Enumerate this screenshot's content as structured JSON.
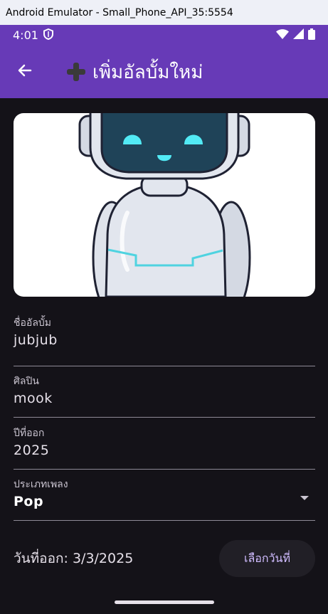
{
  "window": {
    "title": "Android Emulator - Small_Phone_API_35:5554"
  },
  "status_bar": {
    "time": "4:01",
    "icons": [
      "shield-icon",
      "wifi-icon",
      "signal-icon",
      "battery-icon"
    ]
  },
  "app_bar": {
    "title": "เพิ่มอัลบั้มใหม่",
    "back_icon": "arrow-back-icon",
    "title_icon": "heavy-plus-emoji"
  },
  "hero": {
    "image": "robot-illustration"
  },
  "form": {
    "album_name": {
      "label": "ชื่ออัลบั้ม",
      "value": "jubjub"
    },
    "artist": {
      "label": "ศิลปิน",
      "value": "mook"
    },
    "release_year": {
      "label": "ปีที่ออก",
      "value": "2025"
    },
    "genre": {
      "label": "ประเภทเพลง",
      "value": "Pop"
    }
  },
  "release_date": {
    "text": "วันที่ออก: 3/3/2025",
    "button_label": "เลือกวันที่"
  },
  "colors": {
    "app_bar": "#673ab7",
    "background": "#141218",
    "accent": "#d0bcff"
  }
}
